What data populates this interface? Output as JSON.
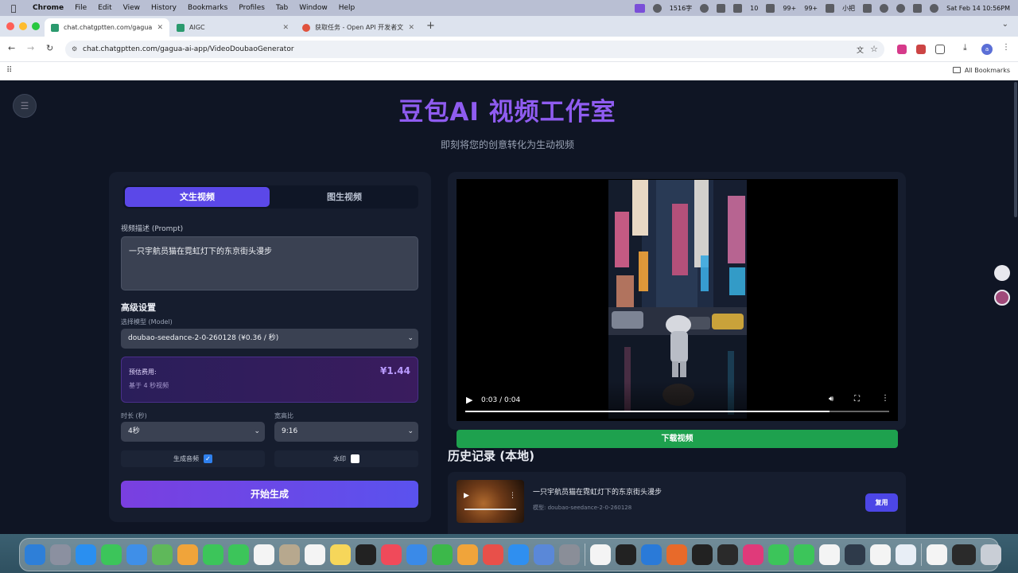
{
  "menubar": {
    "app": "Chrome",
    "items": [
      "File",
      "Edit",
      "View",
      "History",
      "Bookmarks",
      "Profiles",
      "Tab",
      "Window",
      "Help"
    ],
    "status": {
      "words": "1516字",
      "count10": "10",
      "wechat": "99+",
      "wechat2": "99+",
      "input_method": "小把",
      "datetime": "Sat Feb 14  10:56PM"
    }
  },
  "browser": {
    "tabs": [
      {
        "title": "chat.chatgptten.com/gagua-ai-app/VideoDoubaoGenerator",
        "favicon_color": "#2b9a6e"
      },
      {
        "title": "AIGC",
        "favicon_color": "#2b9a6e"
      },
      {
        "title": "获取任务 - Open API 开发者文档",
        "favicon_color": "#e0523d"
      }
    ],
    "url": "chat.chatgptten.com/gagua-ai-app/VideoDoubaoGenerator",
    "avatar_letter": "a",
    "bookmarks_label": "All Bookmarks"
  },
  "page": {
    "title": "豆包AI 视频工作室",
    "subtitle": "即刻将您的创意转化为生动视频",
    "modes": [
      "文生视频",
      "图生视频"
    ],
    "prompt_label": "视频描述 (Prompt)",
    "prompt_value": "一只宇航员猫在霓虹灯下的东京街头漫步",
    "advanced_label": "高级设置",
    "model_label": "选择模型 (Model)",
    "model_value": "doubao-seedance-2-0-260128 (¥0.36 / 秒)",
    "cost": {
      "label": "预估费用:",
      "basis": "基于 4 秒视频",
      "price": "¥1.44"
    },
    "duration_label": "时长 (秒)",
    "duration_value": "4秒",
    "ratio_label": "宽高比",
    "ratio_value": "9:16",
    "audio_label": "生成音频",
    "audio_checked": true,
    "watermark_label": "水印",
    "watermark_checked": false,
    "generate_label": "开始生成",
    "video": {
      "time": "0:03 / 0:04",
      "progress": 0.86
    },
    "download_label": "下载视频",
    "history_title": "历史记录 (本地)",
    "history": [
      {
        "prompt": "一只宇航员猫在霓虹灯下的东京街头漫步",
        "model": "模型: doubao-seedance-2-0-260128",
        "reuse_label": "复用"
      }
    ]
  },
  "colors": {
    "accent": "#5b48e8",
    "title_purple": "#8f5cf0",
    "download_green": "#1ea14e",
    "page_bg": "#0f1524",
    "card_bg": "#161d2e"
  }
}
